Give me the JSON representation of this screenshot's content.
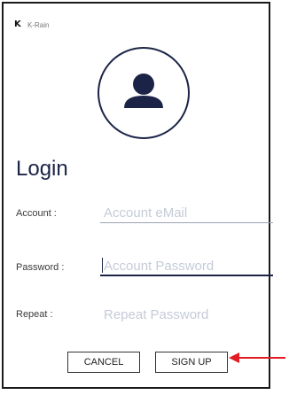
{
  "app": {
    "name": "K-Rain",
    "logo_icon": "K"
  },
  "avatar": {
    "icon": "user-icon",
    "accent": "#1b2447"
  },
  "title": "Login",
  "form": {
    "account": {
      "label": "Account :",
      "placeholder": "Account eMail"
    },
    "password": {
      "label": "Password :",
      "placeholder": "Account Password"
    },
    "repeat": {
      "label": "Repeat :",
      "placeholder": "Repeat Password"
    }
  },
  "buttons": {
    "cancel": "CANCEL",
    "signup": "SIGN UP"
  },
  "annotation": {
    "icon": "red-arrow-icon",
    "color": "#e31b23"
  }
}
